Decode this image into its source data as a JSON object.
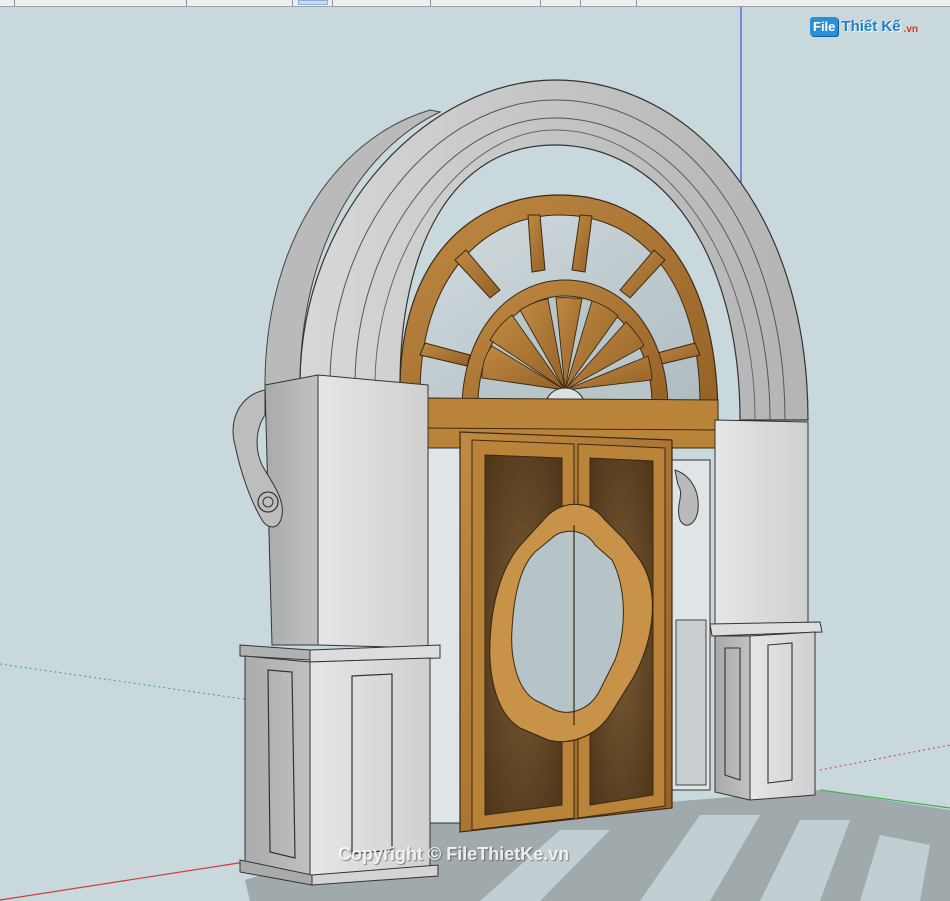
{
  "watermark": {
    "logo_box": "File",
    "logo_text": "Thiết Kế",
    "logo_domain": ".vn",
    "copyright": "Copyright © FileThietKe.vn"
  },
  "scene": {
    "subject": "arched-double-door-model",
    "colors": {
      "background": "#c9d8dd",
      "stone": "#c8c9c8",
      "stone_light": "#e2e3e2",
      "stone_dark": "#9c9e9d",
      "wood": "#b07a35",
      "wood_dark": "#7a5220",
      "panel": "#6b4f2c",
      "glass": "#c2ced2",
      "axis_blue": "#3a55d8",
      "axis_red": "#d03b3b",
      "axis_green": "#39b14a"
    }
  }
}
